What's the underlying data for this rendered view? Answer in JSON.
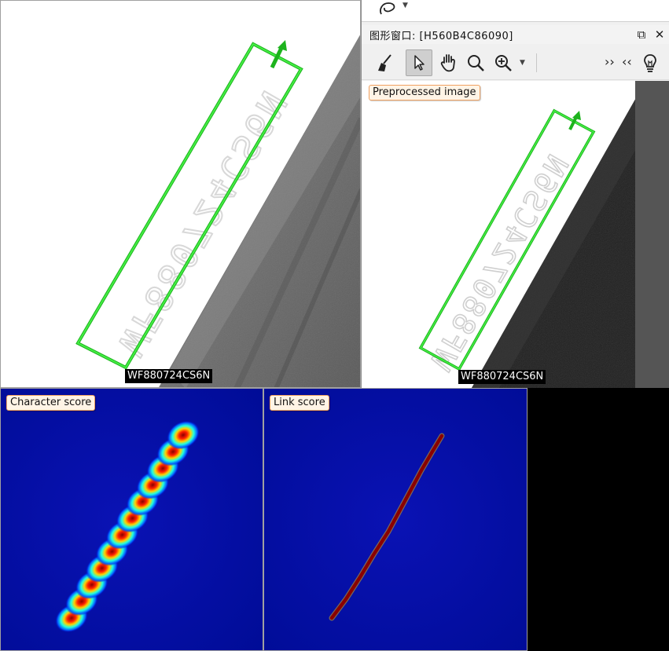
{
  "original_view": {
    "result_text": "WF880724CS6N",
    "box_color": "#22cc22"
  },
  "graphics_window": {
    "title": "图形窗口:  [H560B4C86090]",
    "restore_icon": "restore-window-icon",
    "close_icon": "close-icon",
    "toolbar": {
      "tools": [
        "broom-icon",
        "pointer-icon",
        "hand-icon",
        "magnifier-icon",
        "zoom-in-icon",
        "lightbulb-icon"
      ],
      "expand_label": "››",
      "collapse_label": "‹‹"
    },
    "overlay_label": "Preprocessed image",
    "result_text": "WF880724CS6N"
  },
  "heatmaps": {
    "character_score_label": "Character score",
    "link_score_label": "Link score",
    "colormap": [
      "#00008b",
      "#0000ff",
      "#00ffff",
      "#ffff00",
      "#ff0000",
      "#8b0000"
    ]
  }
}
